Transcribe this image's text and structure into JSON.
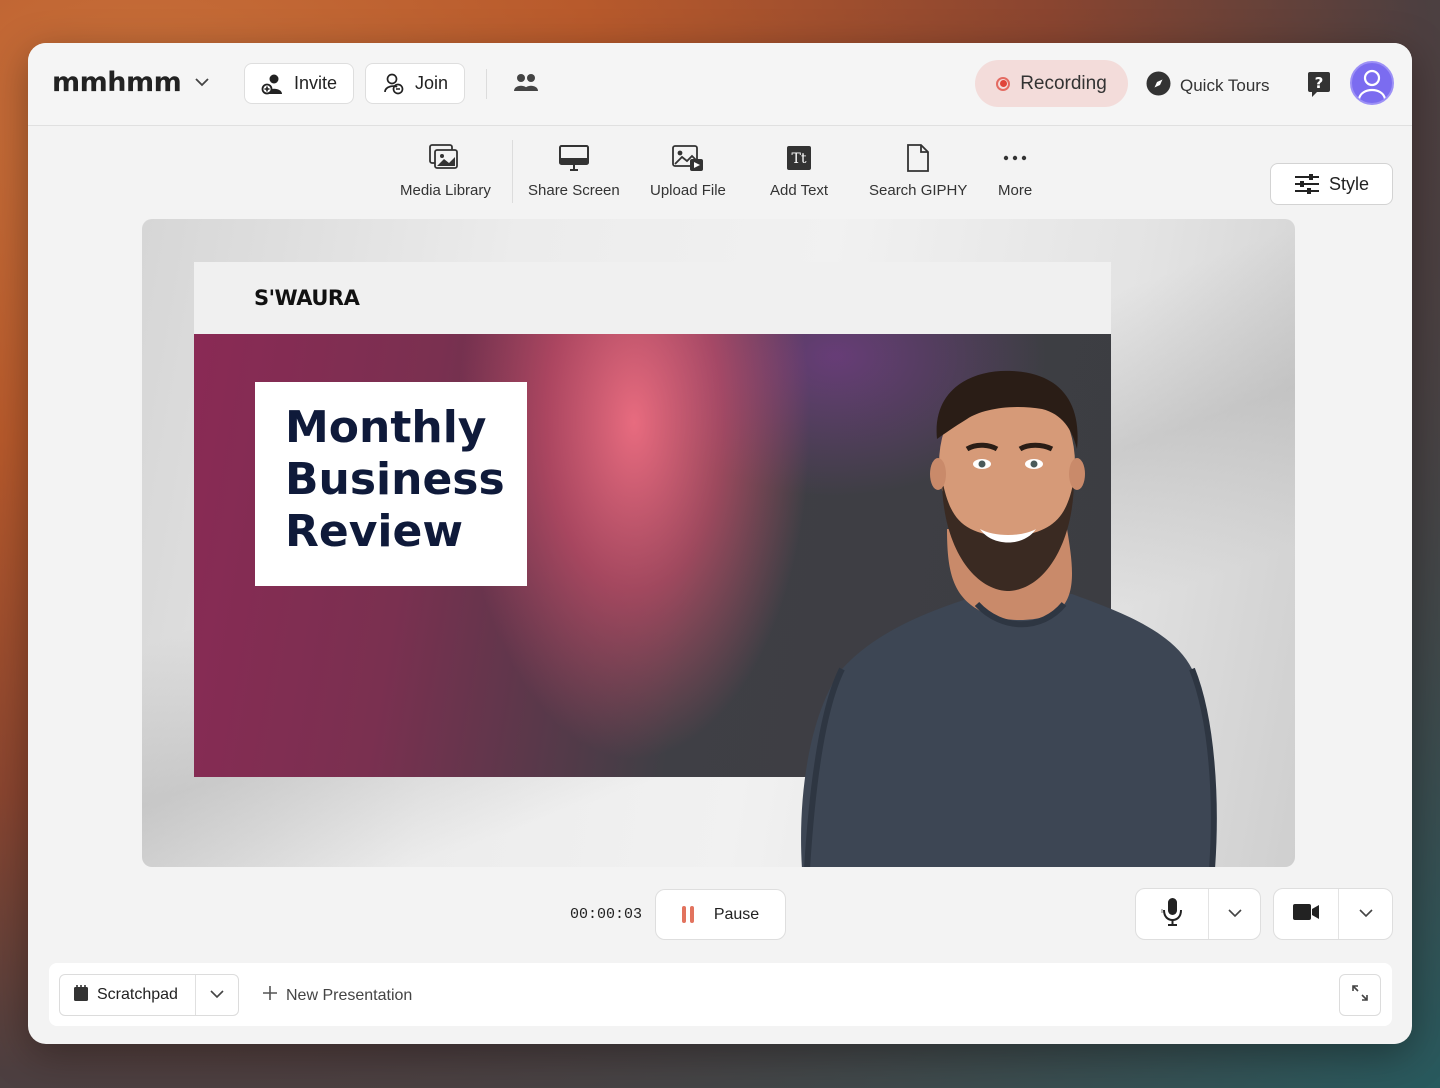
{
  "app": {
    "logo": "mmhmm"
  },
  "header": {
    "invite_label": "Invite",
    "join_label": "Join",
    "recording_label": "Recording",
    "quick_tours_label": "Quick Tours"
  },
  "toolbar": {
    "items": [
      {
        "label": "Media Library",
        "icon": "media-library-icon"
      },
      {
        "label": "Share Screen",
        "icon": "monitor-icon"
      },
      {
        "label": "Upload File",
        "icon": "upload-file-icon"
      },
      {
        "label": "Add Text",
        "icon": "text-icon"
      },
      {
        "label": "Search GIPHY",
        "icon": "file-icon"
      },
      {
        "label": "More",
        "icon": "more-dots-icon"
      }
    ],
    "style_label": "Style"
  },
  "slide": {
    "brand": "S'WAURA",
    "title_lines": [
      "Monthly",
      "Business",
      "Review"
    ]
  },
  "controls": {
    "timer": "00:00:03",
    "pause_label": "Pause"
  },
  "bottom": {
    "scratchpad_label": "Scratchpad",
    "new_presentation_label": "New Presentation"
  },
  "colors": {
    "recording_bg": "#f3dcda",
    "recording_dot": "#e0453a",
    "pause_icon": "#e2735e",
    "avatar": "#7b6cf0",
    "title_text": "#0f1a3a"
  }
}
